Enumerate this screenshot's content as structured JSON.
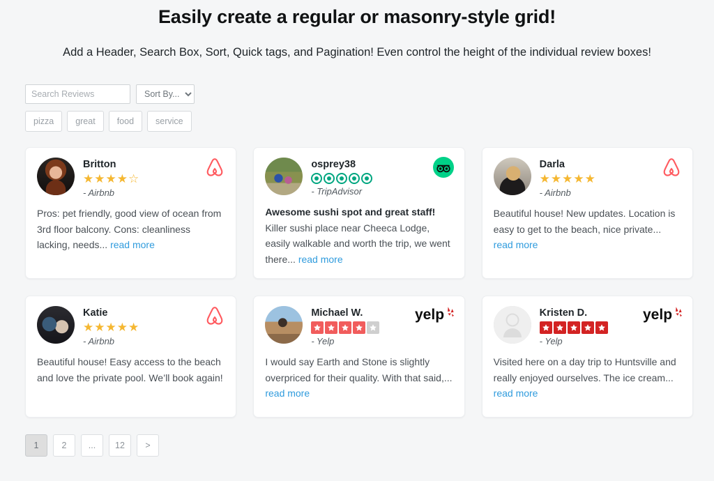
{
  "header": {
    "title": "Easily create a regular or masonry-style grid!",
    "subtitle": "Add a Header, Search Box, Sort, Quick tags, and Pagination! Even control the height of the individual review boxes!"
  },
  "controls": {
    "search_placeholder": "Search Reviews",
    "search_value": "",
    "sort_selected": "Sort By...",
    "sort_options": [
      "Sort By..."
    ],
    "tags": [
      {
        "label": "pizza"
      },
      {
        "label": "great"
      },
      {
        "label": "food"
      },
      {
        "label": "service"
      }
    ]
  },
  "colors": {
    "page_background": "#f5f6f7",
    "card_background": "#ffffff",
    "airbnb_red": "#ff5a5f",
    "tripadvisor_green": "#00d188",
    "tripadvisor_rating_green": "#00a680",
    "yelp_red": "#d32323",
    "yelp_light_red": "#f15c5c",
    "star_gold": "#f5b731",
    "link_blue": "#2f9bdd"
  },
  "reviews": [
    {
      "name": "Britton",
      "source": "- Airbnb",
      "platform": "airbnb",
      "rating": 4,
      "rating_max": 5,
      "avatar": "ph-britton",
      "title": "",
      "text": "Pros: pet friendly, good view of ocean from 3rd floor balcony. Cons: cleanliness lacking, needs...",
      "read_more": "read more"
    },
    {
      "name": "osprey38",
      "source": "- TripAdvisor",
      "platform": "tripadvisor",
      "rating": 5,
      "rating_max": 5,
      "avatar": "ph-osprey",
      "title": "Awesome sushi spot and great staff!",
      "text": "Killer sushi place near Cheeca Lodge, easily walkable and worth the trip, we went there...",
      "read_more": "read more"
    },
    {
      "name": "Darla",
      "source": "- Airbnb",
      "platform": "airbnb",
      "rating": 5,
      "rating_max": 5,
      "avatar": "ph-darla",
      "title": "",
      "text": "Beautiful house! New updates. Location is easy to get to the beach, nice private...",
      "read_more": "read more"
    },
    {
      "name": "Katie",
      "source": "- Airbnb",
      "platform": "airbnb",
      "rating": 5,
      "rating_max": 5,
      "avatar": "ph-katie",
      "title": "",
      "text": "Beautiful house! Easy access to the beach and love the private pool. We’ll book again!",
      "read_more": ""
    },
    {
      "name": "Michael W.",
      "source": "- Yelp",
      "platform": "yelp",
      "rating": 4,
      "rating_max": 5,
      "avatar": "ph-michael",
      "title": "",
      "text": "I would say Earth and Stone is slightly overpriced for their quality. With that said,...",
      "read_more": "read more"
    },
    {
      "name": "Kristen D.",
      "source": "- Yelp",
      "platform": "yelp",
      "rating": 5,
      "rating_max": 5,
      "avatar": "ph-blank",
      "title": "",
      "text": "Visited here on a day trip to Huntsville and really enjoyed ourselves. The ice cream...",
      "read_more": "read more"
    }
  ],
  "pagination": {
    "pages": [
      {
        "label": "1",
        "active": true
      },
      {
        "label": "2",
        "active": false
      },
      {
        "label": "...",
        "active": false
      },
      {
        "label": "12",
        "active": false
      },
      {
        "label": ">",
        "active": false
      }
    ]
  }
}
